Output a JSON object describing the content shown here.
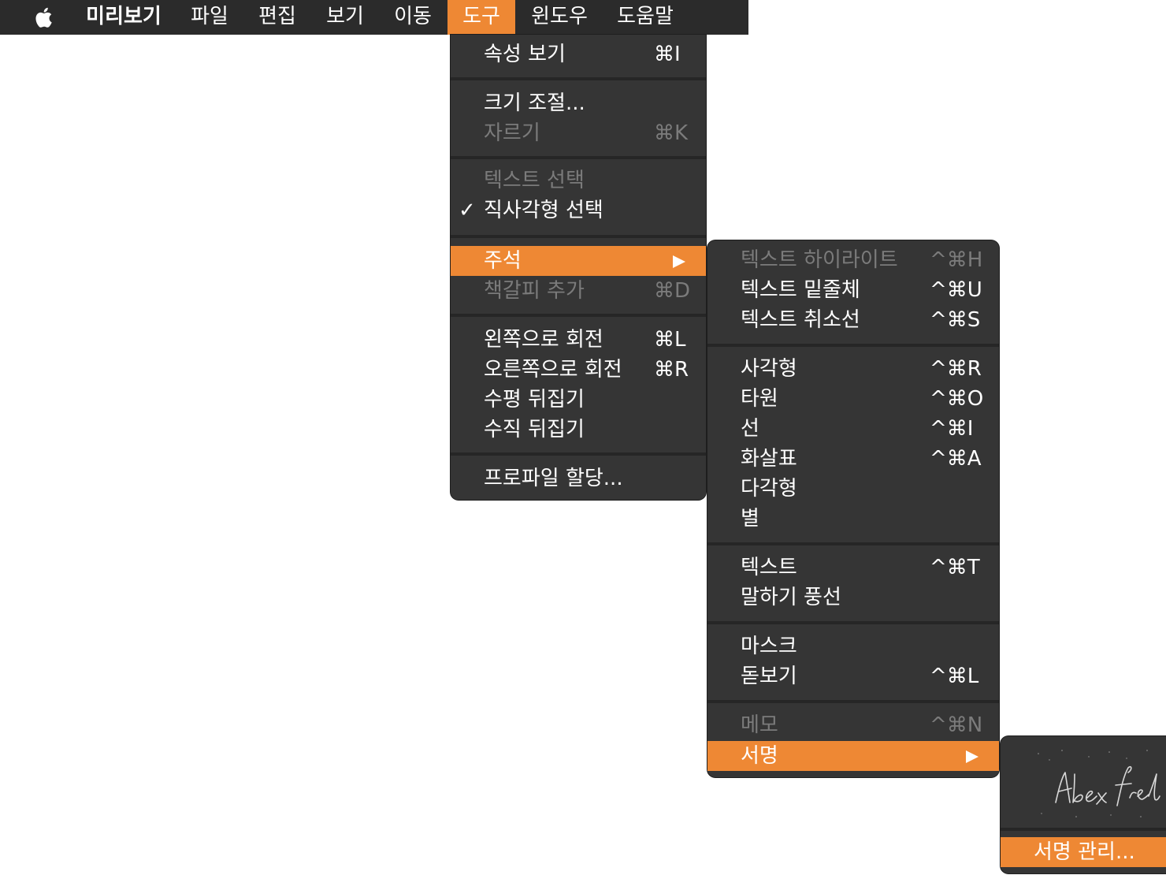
{
  "menubar": {
    "apple_icon": "apple-logo-icon",
    "items": [
      "미리보기",
      "파일",
      "편집",
      "보기",
      "이동",
      "도구",
      "윈도우",
      "도움말"
    ],
    "active_index": 5
  },
  "tools_menu": {
    "sections": [
      [
        {
          "label": "속성 보기",
          "shortcut": "⌘I"
        }
      ],
      [
        {
          "label": "크기 조절...",
          "shortcut": ""
        },
        {
          "label": "자르기",
          "shortcut": "⌘K",
          "disabled": true
        }
      ],
      [
        {
          "label": "텍스트 선택",
          "shortcut": "",
          "disabled": true
        },
        {
          "label": "직사각형 선택",
          "shortcut": "",
          "checked": true
        }
      ],
      [
        {
          "label": "주석",
          "shortcut": "",
          "submenu": true,
          "highlighted": true
        },
        {
          "label": "책갈피 추가",
          "shortcut": "⌘D",
          "disabled": true
        }
      ],
      [
        {
          "label": "왼쪽으로 회전",
          "shortcut": "⌘L"
        },
        {
          "label": "오른쪽으로 회전",
          "shortcut": "⌘R"
        },
        {
          "label": "수평 뒤집기",
          "shortcut": ""
        },
        {
          "label": "수직 뒤집기",
          "shortcut": ""
        }
      ],
      [
        {
          "label": "프로파일 할당...",
          "shortcut": ""
        }
      ]
    ]
  },
  "annotate_menu": {
    "sections": [
      [
        {
          "label": "텍스트 하이라이트",
          "shortcut": "^⌘H",
          "disabled": true
        },
        {
          "label": "텍스트 밑줄체",
          "shortcut": "^⌘U"
        },
        {
          "label": "텍스트 취소선",
          "shortcut": "^⌘S"
        }
      ],
      [
        {
          "label": "사각형",
          "shortcut": "^⌘R"
        },
        {
          "label": "타원",
          "shortcut": "^⌘O"
        },
        {
          "label": "선",
          "shortcut": "^⌘I"
        },
        {
          "label": "화살표",
          "shortcut": "^⌘A"
        },
        {
          "label": "다각형",
          "shortcut": ""
        },
        {
          "label": "별",
          "shortcut": ""
        }
      ],
      [
        {
          "label": "텍스트",
          "shortcut": "^⌘T"
        },
        {
          "label": "말하기 풍선",
          "shortcut": ""
        }
      ],
      [
        {
          "label": "마스크",
          "shortcut": ""
        },
        {
          "label": "돋보기",
          "shortcut": "^⌘L"
        }
      ],
      [
        {
          "label": "메모",
          "shortcut": "^⌘N",
          "disabled": true
        },
        {
          "label": "서명",
          "shortcut": "",
          "submenu": true,
          "highlighted": true
        }
      ]
    ]
  },
  "signature_menu": {
    "signature_image": "handwritten-signature",
    "manage_label": "서명 관리..."
  }
}
